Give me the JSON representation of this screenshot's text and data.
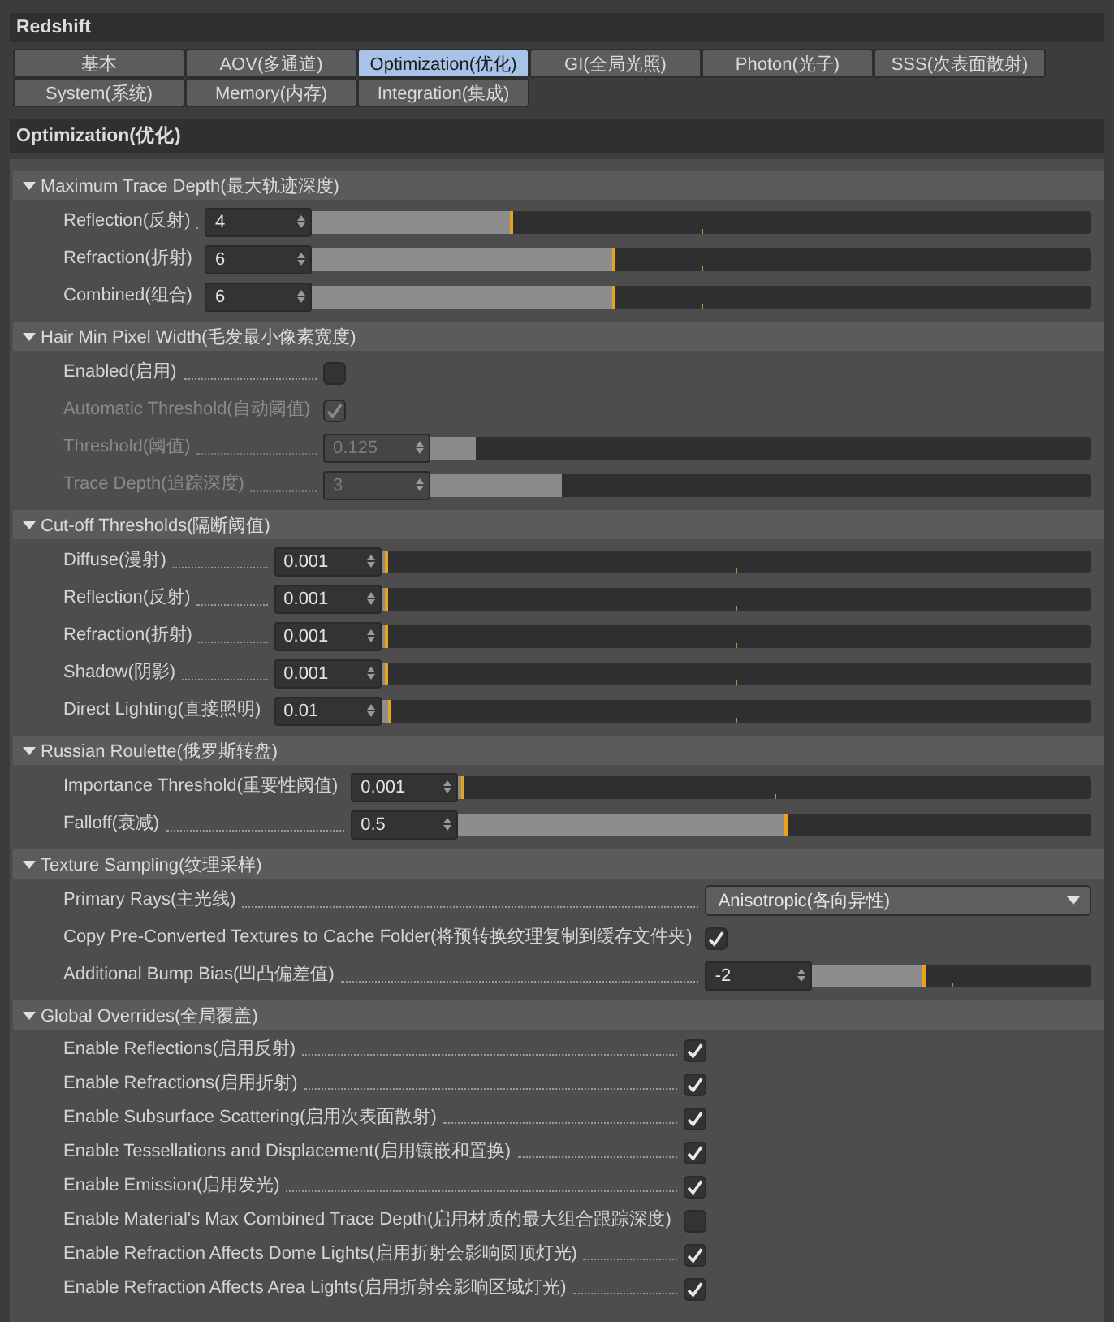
{
  "panel": {
    "title": "Redshift"
  },
  "tabs": [
    {
      "label": "基本",
      "selected": false
    },
    {
      "label": "AOV(多通道)",
      "selected": false
    },
    {
      "label": "Optimization(优化)",
      "selected": true
    },
    {
      "label": "GI(全局光照)",
      "selected": false
    },
    {
      "label": "Photon(光子)",
      "selected": false
    },
    {
      "label": "SSS(次表面散射)",
      "selected": false
    },
    {
      "label": "System(系统)",
      "selected": false
    },
    {
      "label": "Memory(内存)",
      "selected": false
    },
    {
      "label": "Integration(集成)",
      "selected": false
    }
  ],
  "section": {
    "title": "Optimization(优化)"
  },
  "groups": [
    {
      "title": "Maximum Trace Depth(最大轨迹深度)",
      "expanded": true,
      "rows": [
        {
          "kind": "number",
          "label": "Reflection(反射)",
          "value": "4",
          "level": 0.25,
          "disabled": false
        },
        {
          "kind": "number",
          "label": "Refraction(折射)",
          "value": "6",
          "level": 0.38,
          "disabled": false
        },
        {
          "kind": "number",
          "label": "Combined(组合)",
          "value": "6",
          "level": 0.38,
          "disabled": false
        }
      ]
    },
    {
      "title": "Hair Min Pixel Width(毛发最小像素宽度)",
      "expanded": true,
      "rows": [
        {
          "kind": "checkbox",
          "label": "Enabled(启用)",
          "checked": false,
          "disabled": false
        },
        {
          "kind": "checkbox",
          "label": "Automatic Threshold(自动阈值)",
          "checked": true,
          "disabled": true
        },
        {
          "kind": "number",
          "label": "Threshold(阈值)",
          "value": "0.125",
          "level": 0.06,
          "disabled": true
        },
        {
          "kind": "number",
          "label": "Trace Depth(追踪深度)",
          "value": "3",
          "level": 0.19,
          "disabled": true
        }
      ]
    },
    {
      "title": "Cut-off Thresholds(隔断阈值)",
      "expanded": true,
      "rows": [
        {
          "kind": "number",
          "label": "Diffuse(漫射)",
          "value": "0.001",
          "level": 0.0,
          "disabled": false
        },
        {
          "kind": "number",
          "label": "Reflection(反射)",
          "value": "0.001",
          "level": 0.0,
          "disabled": false
        },
        {
          "kind": "number",
          "label": "Refraction(折射)",
          "value": "0.001",
          "level": 0.0,
          "disabled": false
        },
        {
          "kind": "number",
          "label": "Shadow(阴影)",
          "value": "0.001",
          "level": 0.0,
          "disabled": false
        },
        {
          "kind": "number",
          "label": "Direct Lighting(直接照明)",
          "value": "0.01",
          "level": 0.006,
          "disabled": false
        }
      ]
    },
    {
      "title": "Russian Roulette(俄罗斯转盘)",
      "expanded": true,
      "rows": [
        {
          "kind": "number",
          "label": "Importance Threshold(重要性阈值)",
          "value": "0.001",
          "level": 0.0,
          "disabled": false
        },
        {
          "kind": "number",
          "label": "Falloff(衰减)",
          "value": "0.5",
          "level": 0.51,
          "disabled": false
        }
      ]
    },
    {
      "title": "Texture Sampling(纹理采样)",
      "expanded": true,
      "rows": [
        {
          "kind": "dropdown",
          "label": "Primary Rays(主光线)",
          "value": "Anisotropic(各向异性)",
          "disabled": false
        },
        {
          "kind": "checkbox",
          "label": "Copy Pre-Converted Textures to Cache Folder(将预转换纹理复制到缓存文件夹)",
          "checked": true,
          "disabled": false
        },
        {
          "kind": "number",
          "label": "Additional Bump Bias(凹凸偏差值)",
          "value": "-2",
          "level": 0.38,
          "disabled": false
        }
      ]
    },
    {
      "title": "Global Overrides(全局覆盖)",
      "expanded": true,
      "rows": [
        {
          "kind": "checkbox",
          "label": "Enable Reflections(启用反射)",
          "checked": true,
          "disabled": false
        },
        {
          "kind": "checkbox",
          "label": "Enable Refractions(启用折射)",
          "checked": true,
          "disabled": false
        },
        {
          "kind": "checkbox",
          "label": "Enable Subsurface Scattering(启用次表面散射)",
          "checked": true,
          "disabled": false
        },
        {
          "kind": "checkbox",
          "label": "Enable Tessellations and Displacement(启用镶嵌和置换)",
          "checked": true,
          "disabled": false
        },
        {
          "kind": "checkbox",
          "label": "Enable Emission(启用发光)",
          "checked": true,
          "disabled": false
        },
        {
          "kind": "checkbox",
          "label": "Enable Material's Max Combined Trace Depth(启用材质的最大组合跟踪深度)",
          "checked": false,
          "disabled": false
        },
        {
          "kind": "checkbox",
          "label": "Enable Refraction Affects Dome Lights(启用折射会影响圆顶灯光)",
          "checked": true,
          "disabled": false
        },
        {
          "kind": "checkbox",
          "label": "Enable Refraction Affects Area Lights(启用折射会影响区域灯光)",
          "checked": true,
          "disabled": false
        }
      ]
    }
  ]
}
